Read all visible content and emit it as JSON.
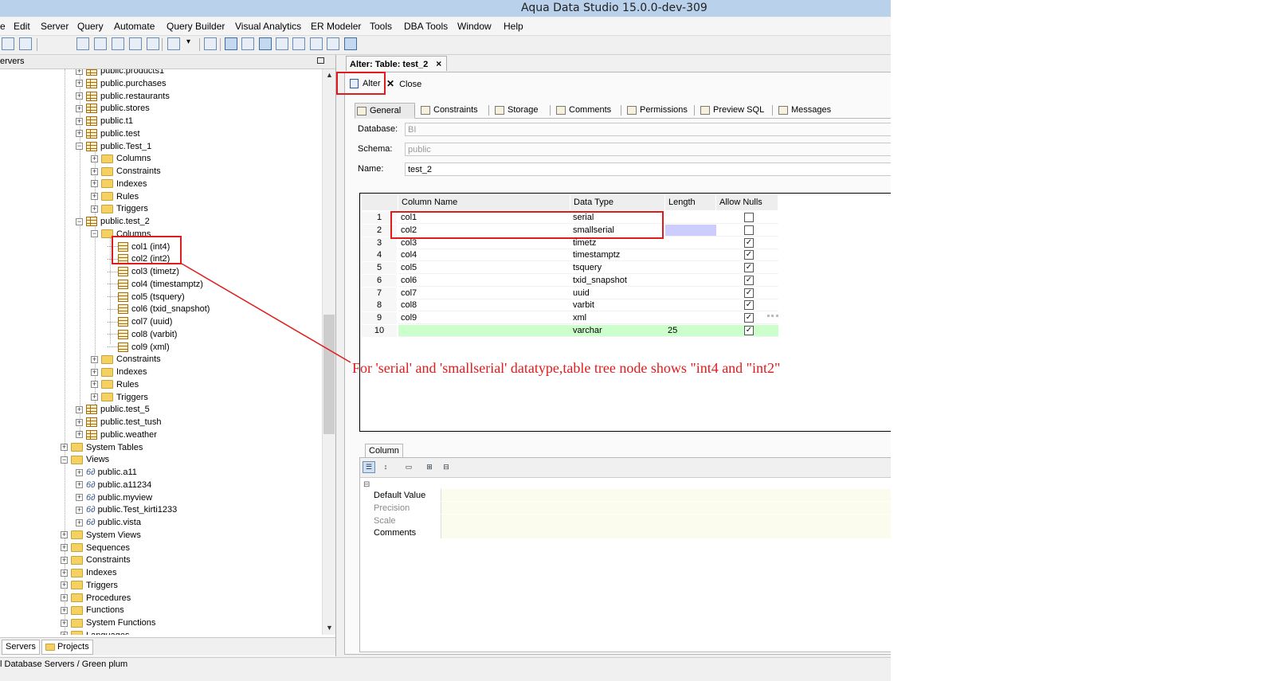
{
  "window": {
    "title": "Aqua Data Studio 15.0.0-dev-309"
  },
  "menu": [
    "e",
    "Edit",
    "Server",
    "Query",
    "Automate",
    "Query Builder",
    "Visual Analytics",
    "ER Modeler",
    "Tools",
    "DBA Tools",
    "Window",
    "Help"
  ],
  "left_panel": {
    "header": "ervers",
    "tree": [
      {
        "label": "public.products1",
        "icon": "table-icon",
        "level": 1,
        "exp": "+"
      },
      {
        "label": "public.purchases",
        "icon": "table-icon",
        "level": 1,
        "exp": "+"
      },
      {
        "label": "public.restaurants",
        "icon": "table-icon",
        "level": 1,
        "exp": "+"
      },
      {
        "label": "public.stores",
        "icon": "table-icon",
        "level": 1,
        "exp": "+"
      },
      {
        "label": "public.t1",
        "icon": "table-icon",
        "level": 1,
        "exp": "+"
      },
      {
        "label": "public.test",
        "icon": "table-icon",
        "level": 1,
        "exp": "+"
      },
      {
        "label": "public.Test_1",
        "icon": "table-icon",
        "level": 1,
        "exp": "-"
      },
      {
        "label": "Columns",
        "icon": "folder-icon",
        "level": 2,
        "exp": "+"
      },
      {
        "label": "Constraints",
        "icon": "folder-icon",
        "level": 2,
        "exp": "+"
      },
      {
        "label": "Indexes",
        "icon": "folder-icon",
        "level": 2,
        "exp": "+"
      },
      {
        "label": "Rules",
        "icon": "folder-icon",
        "level": 2,
        "exp": "+"
      },
      {
        "label": "Triggers",
        "icon": "folder-icon",
        "level": 2,
        "exp": "+"
      },
      {
        "label": "public.test_2",
        "icon": "table-icon",
        "level": 1,
        "exp": "-"
      },
      {
        "label": "Columns",
        "icon": "folder-icon",
        "level": 2,
        "exp": "-"
      },
      {
        "label": "col1 (int4)",
        "icon": "column-icon",
        "level": 3,
        "exp": ""
      },
      {
        "label": "col2 (int2)",
        "icon": "column-icon",
        "level": 3,
        "exp": ""
      },
      {
        "label": "col3 (timetz)",
        "icon": "column-icon",
        "level": 3,
        "exp": ""
      },
      {
        "label": "col4 (timestamptz)",
        "icon": "column-icon",
        "level": 3,
        "exp": ""
      },
      {
        "label": "col5 (tsquery)",
        "icon": "column-icon",
        "level": 3,
        "exp": ""
      },
      {
        "label": "col6 (txid_snapshot)",
        "icon": "column-icon",
        "level": 3,
        "exp": ""
      },
      {
        "label": "col7 (uuid)",
        "icon": "column-icon",
        "level": 3,
        "exp": ""
      },
      {
        "label": "col8 (varbit)",
        "icon": "column-icon",
        "level": 3,
        "exp": ""
      },
      {
        "label": "col9 (xml)",
        "icon": "column-icon",
        "level": 3,
        "exp": ""
      },
      {
        "label": "Constraints",
        "icon": "folder-icon",
        "level": 2,
        "exp": "+"
      },
      {
        "label": "Indexes",
        "icon": "folder-icon",
        "level": 2,
        "exp": "+"
      },
      {
        "label": "Rules",
        "icon": "folder-icon",
        "level": 2,
        "exp": "+"
      },
      {
        "label": "Triggers",
        "icon": "folder-icon",
        "level": 2,
        "exp": "+"
      },
      {
        "label": "public.test_5",
        "icon": "table-icon",
        "level": 1,
        "exp": "+"
      },
      {
        "label": "public.test_tush",
        "icon": "table-icon",
        "level": 1,
        "exp": "+"
      },
      {
        "label": "public.weather",
        "icon": "table-icon",
        "level": 1,
        "exp": "+"
      },
      {
        "label": "System Tables",
        "icon": "folder-icon",
        "level": 0,
        "exp": "+"
      },
      {
        "label": "Views",
        "icon": "folder-icon",
        "level": 0,
        "exp": "-"
      },
      {
        "label": "public.a11",
        "icon": "view-icon",
        "level": 1,
        "exp": "+"
      },
      {
        "label": "public.a11234",
        "icon": "view-icon",
        "level": 1,
        "exp": "+"
      },
      {
        "label": "public.myview",
        "icon": "view-icon",
        "level": 1,
        "exp": "+"
      },
      {
        "label": "public.Test_kirti1233",
        "icon": "view-icon",
        "level": 1,
        "exp": "+"
      },
      {
        "label": "public.vista",
        "icon": "view-icon",
        "level": 1,
        "exp": "+"
      },
      {
        "label": "System Views",
        "icon": "folder-icon",
        "level": 0,
        "exp": "+"
      },
      {
        "label": "Sequences",
        "icon": "folder-icon",
        "level": 0,
        "exp": "+"
      },
      {
        "label": "Constraints",
        "icon": "folder-icon",
        "level": 0,
        "exp": "+"
      },
      {
        "label": "Indexes",
        "icon": "folder-icon",
        "level": 0,
        "exp": "+"
      },
      {
        "label": "Triggers",
        "icon": "folder-icon",
        "level": 0,
        "exp": "+"
      },
      {
        "label": "Procedures",
        "icon": "folder-icon",
        "level": 0,
        "exp": "+"
      },
      {
        "label": "Functions",
        "icon": "folder-icon",
        "level": 0,
        "exp": "+"
      },
      {
        "label": "System Functions",
        "icon": "folder-icon",
        "level": 0,
        "exp": "+"
      },
      {
        "label": "Languages",
        "icon": "folder-icon",
        "level": 0,
        "exp": "+"
      }
    ],
    "bottom_tabs": [
      "Servers",
      "Projects"
    ]
  },
  "status_bar": "l Database Servers / Green plum",
  "editor": {
    "tab_title": "Alter: Table: test_2",
    "alter_label": "Alter",
    "close_label": "Close",
    "subtabs": [
      "General",
      "Constraints",
      "Storage",
      "Comments",
      "Permissions",
      "Preview SQL",
      "Messages"
    ],
    "database_label": "Database:",
    "database_value": "BI",
    "schema_label": "Schema:",
    "schema_value": "public",
    "name_label": "Name:",
    "name_value": "test_2",
    "grid": {
      "headers": [
        "Column Name",
        "Data Type",
        "Length",
        "Allow Nulls"
      ],
      "rows": [
        {
          "num": "1",
          "name": "col1",
          "type": "serial",
          "length": "",
          "nulls": false
        },
        {
          "num": "2",
          "name": "col2",
          "type": "smallserial",
          "length": "",
          "nulls": false
        },
        {
          "num": "3",
          "name": "col3",
          "type": "timetz",
          "length": "",
          "nulls": true
        },
        {
          "num": "4",
          "name": "col4",
          "type": "timestamptz",
          "length": "",
          "nulls": true
        },
        {
          "num": "5",
          "name": "col5",
          "type": "tsquery",
          "length": "",
          "nulls": true
        },
        {
          "num": "6",
          "name": "col6",
          "type": "txid_snapshot",
          "length": "",
          "nulls": true
        },
        {
          "num": "7",
          "name": "col7",
          "type": "uuid",
          "length": "",
          "nulls": true
        },
        {
          "num": "8",
          "name": "col8",
          "type": "varbit",
          "length": "",
          "nulls": true
        },
        {
          "num": "9",
          "name": "col9",
          "type": "xml",
          "length": "",
          "nulls": true
        },
        {
          "num": "10",
          "name": "",
          "type": "varchar",
          "length": "25",
          "nulls": true
        }
      ]
    },
    "column_panel": {
      "tab": "Column",
      "toggle": "⊟",
      "properties": [
        {
          "key": "Default Value",
          "enabled": true
        },
        {
          "key": "Precision",
          "enabled": false
        },
        {
          "key": "Scale",
          "enabled": false
        },
        {
          "key": "Comments",
          "enabled": true
        }
      ]
    }
  },
  "annotation": {
    "text": "For 'serial' and 'smallserial' datatype,table tree node shows \"int4 and \"int2\"",
    "color": "#e01b1b"
  }
}
